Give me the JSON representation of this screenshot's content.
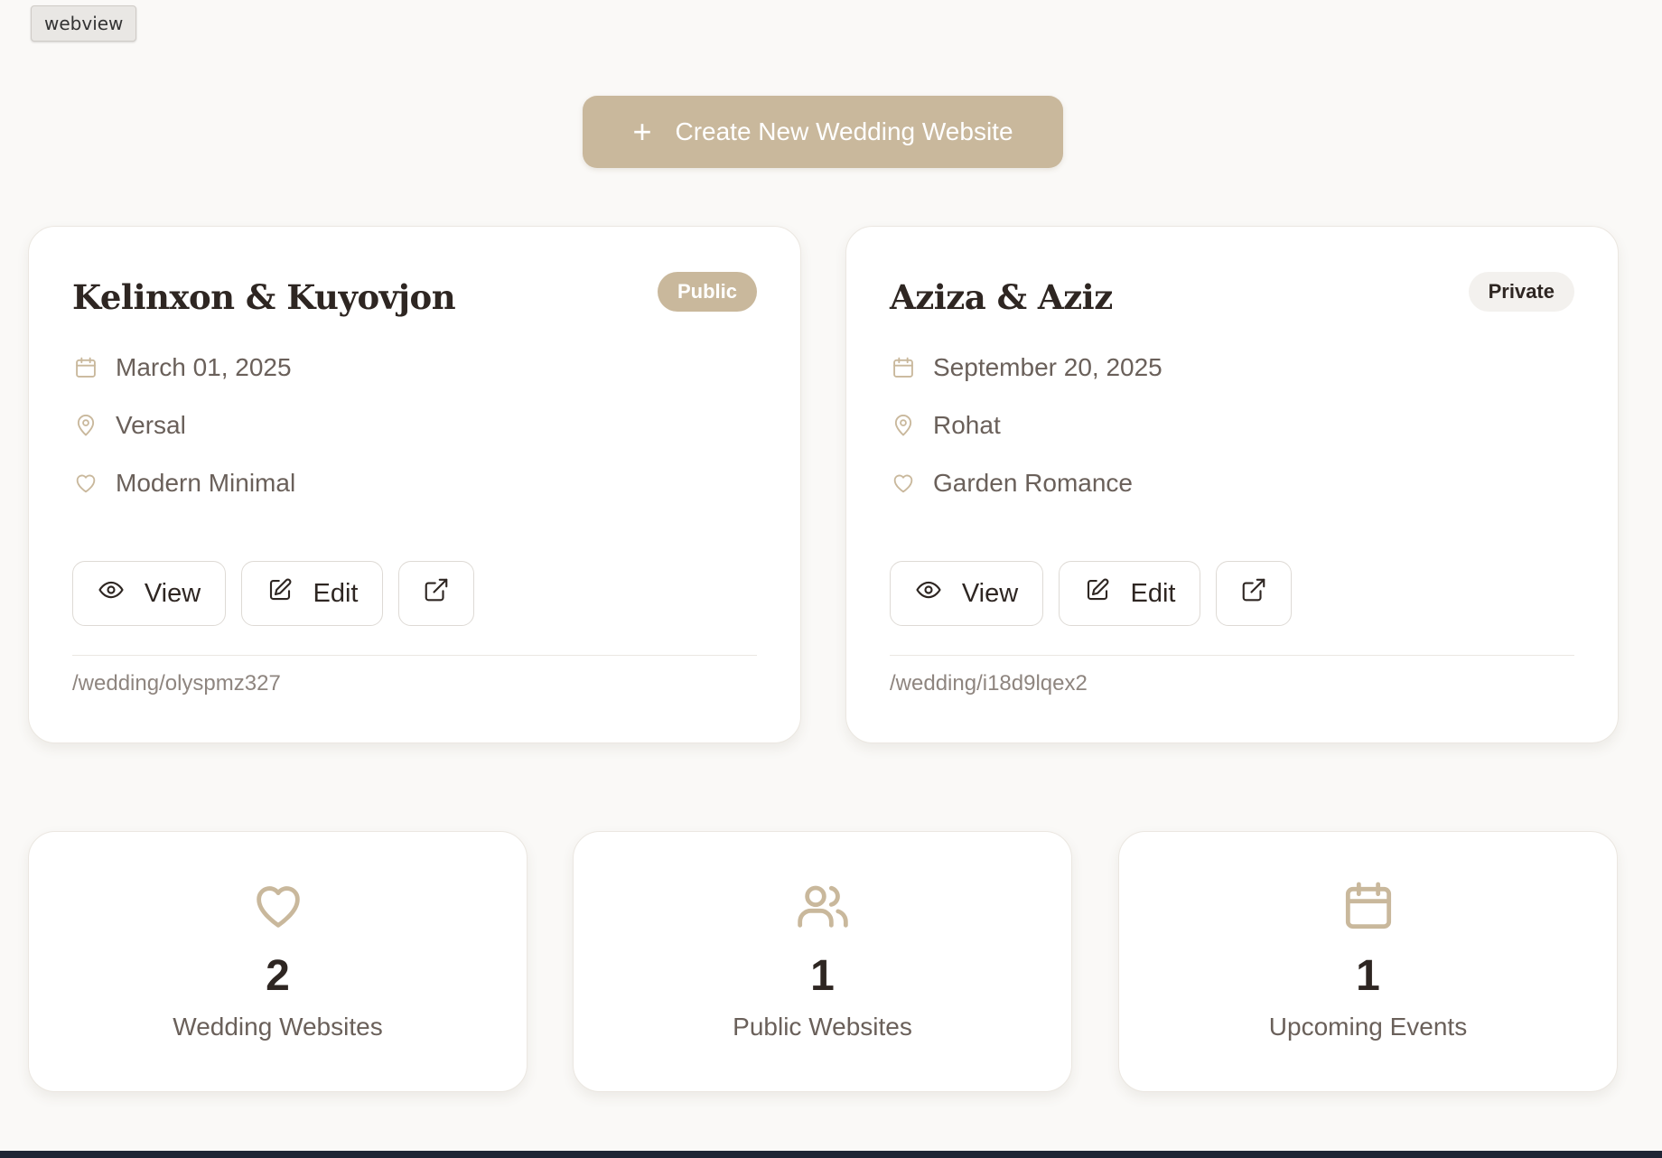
{
  "webview_tag": "webview",
  "create_button": {
    "label": "Create New Wedding Website",
    "icon": "plus-icon"
  },
  "colors": {
    "accent": "#c9b89c",
    "text_dark": "#2e2622",
    "text_muted": "#6a605a",
    "private_badge_bg": "#f3f1ee"
  },
  "websites": [
    {
      "title": "Kelinxon & Kuyovjon",
      "visibility": "Public",
      "date": "March 01, 2025",
      "venue": "Versal",
      "theme": "Modern Minimal",
      "actions": {
        "view": "View",
        "edit": "Edit"
      },
      "slug": "/wedding/olyspmz327"
    },
    {
      "title": "Aziza & Aziz",
      "visibility": "Private",
      "date": "September 20, 2025",
      "venue": "Rohat",
      "theme": "Garden Romance",
      "actions": {
        "view": "View",
        "edit": "Edit"
      },
      "slug": "/wedding/i18d9lqex2"
    }
  ],
  "stats": [
    {
      "icon": "heart-icon",
      "value": "2",
      "label": "Wedding Websites"
    },
    {
      "icon": "users-icon",
      "value": "1",
      "label": "Public Websites"
    },
    {
      "icon": "calendar-icon",
      "value": "1",
      "label": "Upcoming Events"
    }
  ]
}
